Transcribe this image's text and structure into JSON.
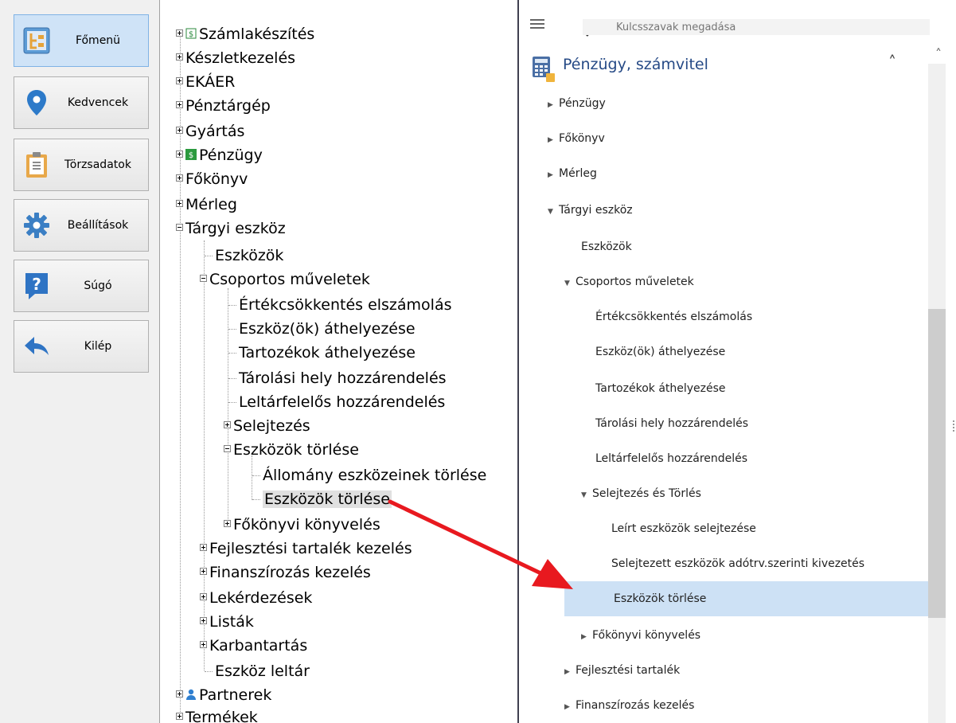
{
  "left_nav": [
    {
      "label": "Főmenü",
      "icon": "main-menu-icon",
      "active": true
    },
    {
      "label": "Kedvencek",
      "icon": "location-pin-icon",
      "active": false
    },
    {
      "label": "Törzsadatok",
      "icon": "clipboard-icon",
      "active": false
    },
    {
      "label": "Beállítások",
      "icon": "gear-icon",
      "active": false
    },
    {
      "label": "Súgó",
      "icon": "help-icon",
      "active": false
    },
    {
      "label": "Kilép",
      "icon": "back-arrow-icon",
      "active": false
    }
  ],
  "tree": {
    "items": [
      {
        "label": "Számlakészítés",
        "icon": "invoice-icon"
      },
      {
        "label": "Készletkezelés"
      },
      {
        "label": "EKÁER"
      },
      {
        "label": "Pénztárgép"
      },
      {
        "label": "Gyártás"
      },
      {
        "label": "Pénzügy",
        "icon": "finance-icon"
      },
      {
        "label": "Főkönyv"
      },
      {
        "label": "Mérleg"
      },
      {
        "label": "Tárgyi eszköz"
      },
      {
        "label": "Eszközök"
      },
      {
        "label": "Csoportos műveletek"
      },
      {
        "label": "Értékcsökkentés elszámolás"
      },
      {
        "label": "Eszköz(ök) áthelyezése"
      },
      {
        "label": "Tartozékok áthelyezése"
      },
      {
        "label": "Tárolási hely hozzárendelés"
      },
      {
        "label": "Leltárfelelős hozzárendelés"
      },
      {
        "label": "Selejtezés"
      },
      {
        "label": "Eszközök törlése"
      },
      {
        "label": "Állomány eszközeinek törlése"
      },
      {
        "label": "Eszközök törlése"
      },
      {
        "label": "Főkönyvi könyvelés"
      },
      {
        "label": "Fejlesztési tartalék kezelés"
      },
      {
        "label": "Finanszírozás kezelés"
      },
      {
        "label": "Lekérdezések"
      },
      {
        "label": "Listák"
      },
      {
        "label": "Karbantartás"
      },
      {
        "label": "Eszköz leltár"
      },
      {
        "label": "Partnerek",
        "icon": "person-icon"
      },
      {
        "label": "Termékek"
      }
    ]
  },
  "menu": {
    "search_placeholder": "Kulcsszavak megadása",
    "section_title": "Pénzügy, számvitel",
    "items": [
      {
        "label": "Pénzügy",
        "arrow": "right"
      },
      {
        "label": "Főkönyv",
        "arrow": "right"
      },
      {
        "label": "Mérleg",
        "arrow": "right"
      },
      {
        "label": "Tárgyi eszköz",
        "arrow": "down"
      },
      {
        "label": "Eszközök",
        "arrow": ""
      },
      {
        "label": "Csoportos műveletek",
        "arrow": "down"
      },
      {
        "label": "Értékcsökkentés elszámolás",
        "arrow": ""
      },
      {
        "label": "Eszköz(ök) áthelyezése",
        "arrow": ""
      },
      {
        "label": "Tartozékok áthelyezése",
        "arrow": ""
      },
      {
        "label": "Tárolási hely hozzárendelés",
        "arrow": ""
      },
      {
        "label": "Leltárfelelős hozzárendelés",
        "arrow": ""
      },
      {
        "label": "Selejtezés és Törlés",
        "arrow": "down"
      },
      {
        "label": "Leírt eszközök selejtezése",
        "arrow": ""
      },
      {
        "label": "Selejtezett eszközök adótrv.szerinti kivezetés",
        "arrow": ""
      },
      {
        "label": "Eszközök törlése",
        "arrow": ""
      },
      {
        "label": "Főkönyvi könyvelés",
        "arrow": "right"
      },
      {
        "label": "Fejlesztési tartalék",
        "arrow": "right"
      },
      {
        "label": "Finanszírozás kezelés",
        "arrow": "right"
      }
    ]
  },
  "colors": {
    "accent": "#264a86",
    "selection": "#cde1f5",
    "arrow": "#e8191f"
  }
}
